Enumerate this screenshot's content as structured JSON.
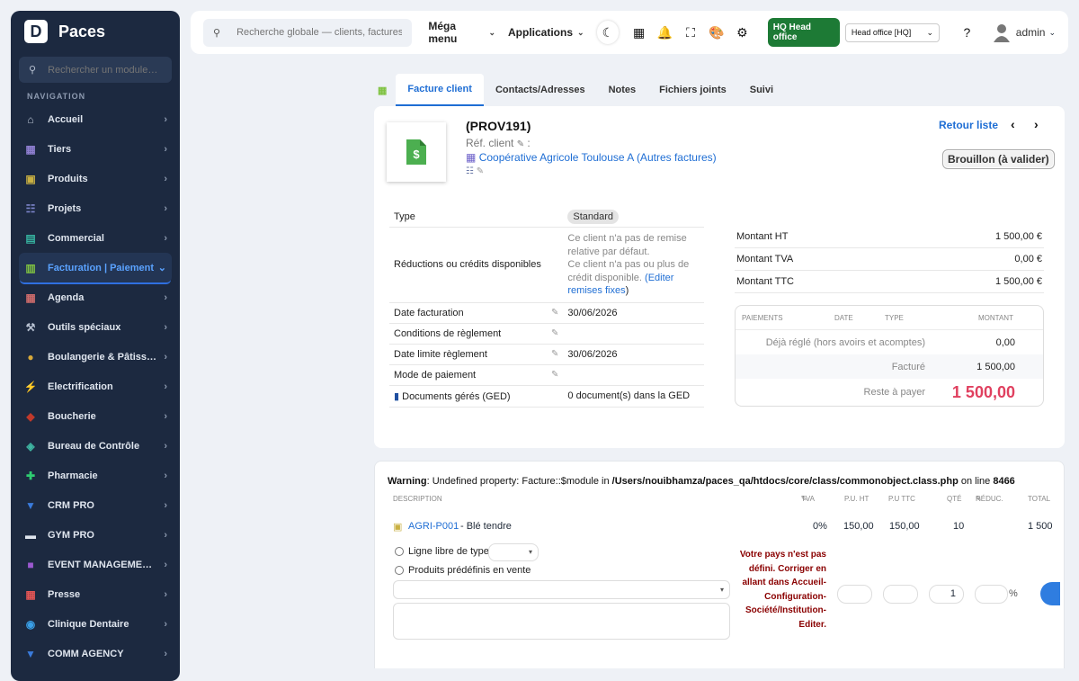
{
  "app": {
    "name": "Paces"
  },
  "sidebar": {
    "search_placeholder": "Rechercher un module…",
    "section_title": "NAVIGATION",
    "items": [
      {
        "label": "Accueil",
        "icon": "home-icon",
        "color": "#b7c1d1"
      },
      {
        "label": "Tiers",
        "icon": "building-icon",
        "color": "#8f7fd1"
      },
      {
        "label": "Produits",
        "icon": "box-icon",
        "color": "#c9b042"
      },
      {
        "label": "Projets",
        "icon": "project-icon",
        "color": "#7b83c9"
      },
      {
        "label": "Commercial",
        "icon": "briefcase-icon",
        "color": "#36b3a0"
      },
      {
        "label": "Facturation | Paiement",
        "icon": "invoice-icon",
        "color": "#7fc241"
      },
      {
        "label": "Agenda",
        "icon": "calendar-icon",
        "color": "#cc6b6b"
      },
      {
        "label": "Outils spéciaux",
        "icon": "tools-icon",
        "color": "#b7c1d1"
      },
      {
        "label": "Boulangerie & Pâtiss…",
        "icon": "bread-icon",
        "color": "#d8a93a"
      },
      {
        "label": "Electrification",
        "icon": "lightning-icon",
        "color": "#f2c21a"
      },
      {
        "label": "Boucherie",
        "icon": "meat-icon",
        "color": "#c0392b"
      },
      {
        "label": "Bureau de Contrôle",
        "icon": "shield-icon",
        "color": "#3fb7a3"
      },
      {
        "label": "Pharmacie",
        "icon": "cross-icon",
        "color": "#2ecc71"
      },
      {
        "label": "CRM PRO",
        "icon": "funnel-icon",
        "color": "#3a7bdc"
      },
      {
        "label": "GYM PRO",
        "icon": "dumbbell-icon",
        "color": "#dfe5ee"
      },
      {
        "label": "EVENT MANAGEME…",
        "icon": "ticket-icon",
        "color": "#9b59d0"
      },
      {
        "label": "Presse",
        "icon": "newspaper-icon",
        "color": "#e25555"
      },
      {
        "label": "Clinique Dentaire",
        "icon": "tooth-icon",
        "color": "#3aa0e8"
      },
      {
        "label": "COMM AGENCY",
        "icon": "megaphone-icon",
        "color": "#3a7bdc"
      }
    ]
  },
  "topbar": {
    "search_placeholder": "Recherche globale — clients, factures, p",
    "mega_menu": "Méga menu",
    "applications": "Applications",
    "hq_badge": "HQ Head office",
    "hq_select": "Head office [HQ]",
    "user": "admin"
  },
  "tabs": [
    "Facture client",
    "Contacts/Adresses",
    "Notes",
    "Fichiers joints",
    "Suivi"
  ],
  "invoice": {
    "ref": "(PROV191)",
    "ref_client_label": "Réf. client",
    "thirdparty": "Coopérative Agricole Toulouse A",
    "thirdparty_suffix": "(Autres factures)",
    "back_label": "Retour liste",
    "status": "Brouillon (à valider)",
    "fields": {
      "type_label": "Type",
      "type_value": "Standard",
      "reductions_label": "Réductions ou crédits disponibles",
      "reductions_text1": "Ce client n'a pas de remise relative par défaut.",
      "reductions_text2": "Ce client n'a pas ou plus de crédit disponible.",
      "reductions_link": "Editer remises fixes",
      "date_label": "Date facturation",
      "date_value": "30/06/2026",
      "conditions_label": "Conditions de règlement",
      "due_label": "Date limite règlement",
      "due_value": "30/06/2026",
      "mode_label": "Mode de paiement",
      "ged_label": "Documents gérés (GED)",
      "ged_value": "0 document(s) dans la GED"
    },
    "amounts": [
      {
        "label": "Montant HT",
        "value": "1 500,00 €"
      },
      {
        "label": "Montant TVA",
        "value": "0,00 €"
      },
      {
        "label": "Montant TTC",
        "value": "1 500,00 €"
      }
    ],
    "payments": {
      "headers": [
        "PAIEMENTS",
        "DATE",
        "TYPE",
        "MONTANT"
      ],
      "already_label": "Déjà réglé (hors avoirs et acomptes)",
      "already_value": "0,00",
      "billed_label": "Facturé",
      "billed_value": "1 500,00",
      "remaining_label": "Reste à payer",
      "remaining_value": "1 500,00",
      "remaining_color": "#e0405f"
    }
  },
  "lines": {
    "warning_prefix": "Warning",
    "warning_text": ": Undefined property: Facture::$module in ",
    "warning_path": "/Users/nouibhamza/paces_qa/htdocs/core/class/commonobject.class.php",
    "warning_mid": " on line ",
    "warning_line": "8466",
    "headers": {
      "description": "DESCRIPTION",
      "tva": "TVA",
      "pu_ht": "P.U. HT",
      "pu_ttc": "P.U TTC",
      "qty": "QTÉ",
      "reduc": "RÉDUC.",
      "total": "TOTAL"
    },
    "row": {
      "code": "AGRI-P001",
      "label": "- Blé tendre",
      "tva": "0%",
      "pu_ht": "150,00",
      "pu_ttc": "150,00",
      "qty": "10",
      "total": "1 500"
    },
    "free_line_label": "Ligne libre de type",
    "predefined_label": "Produits prédéfinis en vente",
    "country_error": "Votre pays n'est pas défini. Corriger en allant dans Accueil-Configuration-Société/Institution-Editer.",
    "qty_default": "1",
    "percent": "%"
  }
}
